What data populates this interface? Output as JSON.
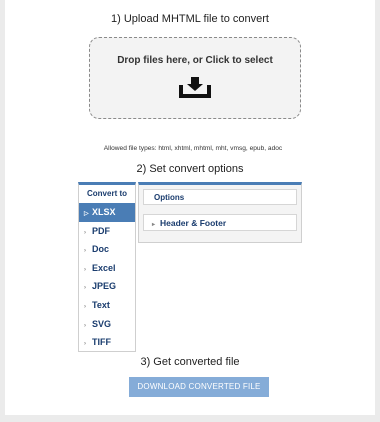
{
  "step1": {
    "label": "1) Upload MHTML file to convert"
  },
  "dropzone": {
    "text": "Drop files here, or Click to select",
    "icon": "download-tray-icon"
  },
  "allowed": {
    "text": "Allowed file types: html, xhtml, mhtml, mht, vmsg, epub, adoc"
  },
  "step2": {
    "label": "2) Set convert options"
  },
  "sidebar": {
    "title": "Convert to",
    "items": [
      {
        "label": "XLSX",
        "active": true
      },
      {
        "label": "PDF"
      },
      {
        "label": "Doc"
      },
      {
        "label": "Excel"
      },
      {
        "label": "JPEG"
      },
      {
        "label": "Text"
      },
      {
        "label": "SVG"
      },
      {
        "label": "TIFF"
      }
    ]
  },
  "options": {
    "header": "Options",
    "items": [
      {
        "label": "Header & Footer"
      }
    ]
  },
  "step3": {
    "label": "3) Get converted file"
  },
  "download": {
    "label": "DOWNLOAD CONVERTED FILE"
  },
  "colors": {
    "accent": "#4a7db5",
    "button": "#85acd8",
    "nav_text": "#1a3c6e"
  }
}
